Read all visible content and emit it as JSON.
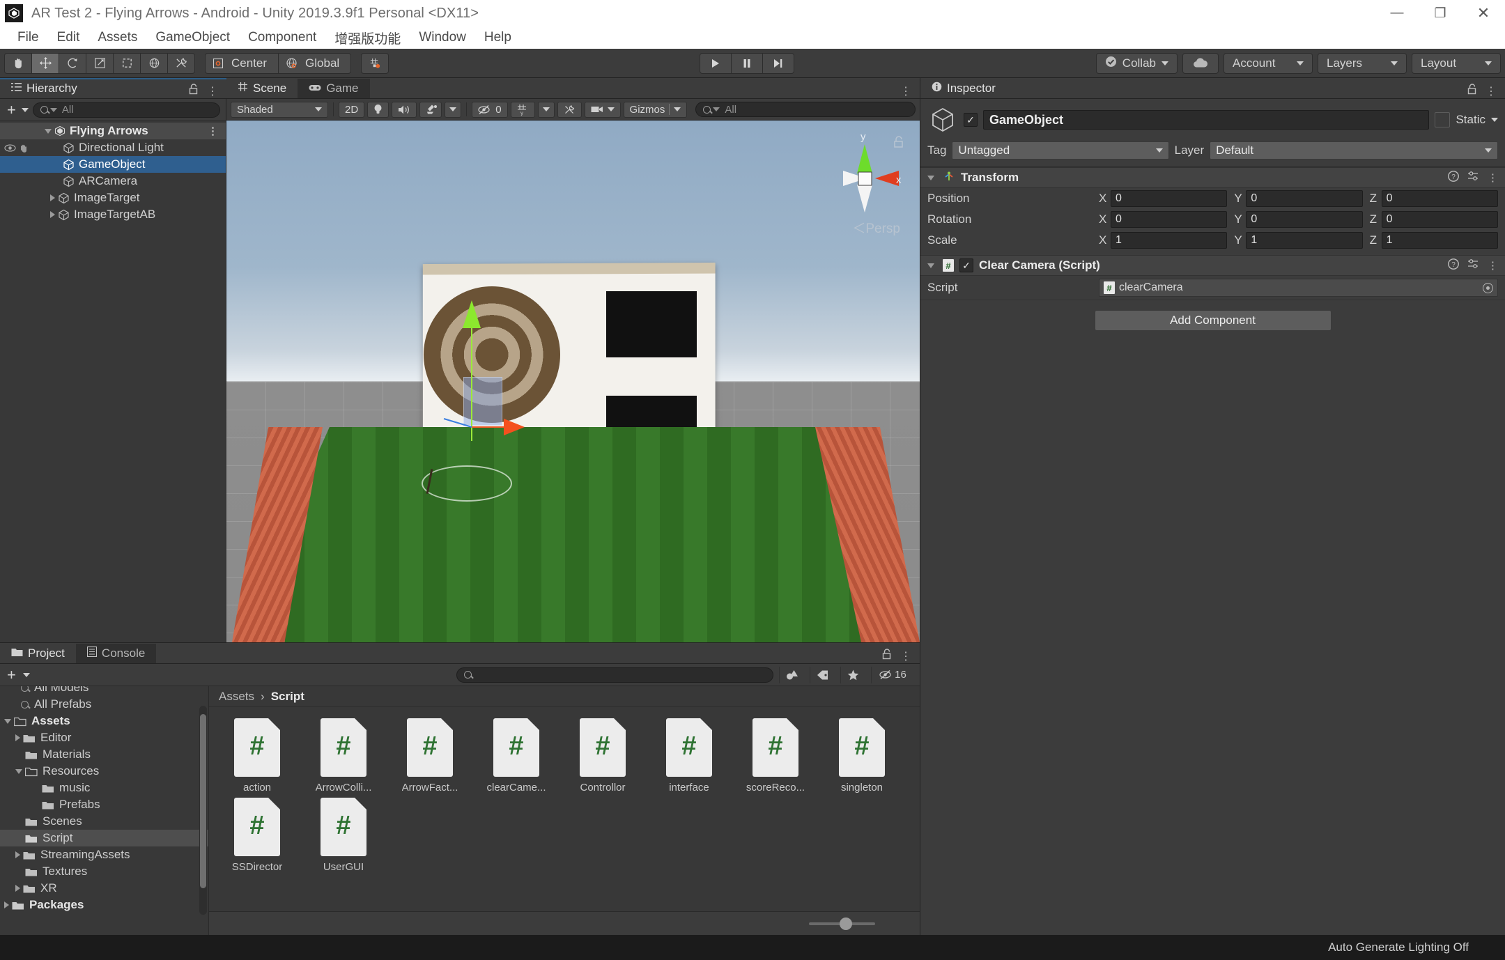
{
  "window": {
    "title": "AR Test 2 - Flying Arrows - Android - Unity 2019.3.9f1 Personal <DX11>",
    "minimize": "—",
    "maximize": "❐",
    "close": "✕"
  },
  "menubar": {
    "items": [
      "File",
      "Edit",
      "Assets",
      "GameObject",
      "Component",
      "增强版功能",
      "Window",
      "Help"
    ]
  },
  "toolbar": {
    "tools": [
      "hand-tool",
      "move-tool",
      "rotate-tool",
      "scale-tool",
      "rect-tool",
      "transform-tool",
      "custom-tool"
    ],
    "pivot_mode": "Center",
    "pivot_rotation": "Global",
    "play": "▶",
    "pause": "❚❚",
    "step": "▶❘",
    "collab": "Collab",
    "account": "Account",
    "layers": "Layers",
    "layout": "Layout"
  },
  "hierarchy": {
    "tab": "Hierarchy",
    "search_placeholder": "All",
    "scene_name": "Flying Arrows",
    "items": [
      {
        "label": "Directional Light",
        "indent": 1,
        "expandable": false,
        "selected": false
      },
      {
        "label": "GameObject",
        "indent": 1,
        "expandable": false,
        "selected": true
      },
      {
        "label": "ARCamera",
        "indent": 1,
        "expandable": false,
        "selected": false
      },
      {
        "label": "ImageTarget",
        "indent": 1,
        "expandable": true,
        "selected": false
      },
      {
        "label": "ImageTargetAB",
        "indent": 1,
        "expandable": true,
        "selected": false
      }
    ]
  },
  "scene": {
    "tabs": [
      {
        "label": "Scene",
        "selected": true
      },
      {
        "label": "Game",
        "selected": false
      }
    ],
    "draw_mode": "Shaded",
    "two_d": "2D",
    "hidden_count": "0",
    "gizmos": "Gizmos",
    "search_placeholder": "All",
    "projection": "Persp",
    "axis_y": "y",
    "axis_x": "x"
  },
  "inspector": {
    "tab": "Inspector",
    "object_name": "GameObject",
    "enabled": true,
    "static_label": "Static",
    "tag_label": "Tag",
    "tag_value": "Untagged",
    "layer_label": "Layer",
    "layer_value": "Default",
    "components": [
      {
        "title": "Transform",
        "rows": [
          {
            "label": "Position",
            "x": "0",
            "y": "0",
            "z": "0"
          },
          {
            "label": "Rotation",
            "x": "0",
            "y": "0",
            "z": "0"
          },
          {
            "label": "Scale",
            "x": "1",
            "y": "1",
            "z": "1"
          }
        ]
      }
    ],
    "script_component": {
      "title": "Clear Camera (Script)",
      "script_label": "Script",
      "script_value": "clearCamera"
    },
    "add_component": "Add Component"
  },
  "project": {
    "tabs": [
      {
        "label": "Project",
        "selected": true
      },
      {
        "label": "Console",
        "selected": false
      }
    ],
    "search_placeholder": "",
    "hidden_count": "16",
    "breadcrumb": [
      "Assets",
      "Script"
    ],
    "tree": [
      {
        "label": "All Models",
        "indent": 1,
        "type": "search",
        "expandable": false,
        "selected": false,
        "clipped": true
      },
      {
        "label": "All Prefabs",
        "indent": 1,
        "type": "search",
        "expandable": false,
        "selected": false
      },
      {
        "label": "Assets",
        "indent": 0,
        "type": "folder-open",
        "expandable": true,
        "expanded": true,
        "selected": false,
        "bold": true
      },
      {
        "label": "Editor",
        "indent": 1,
        "type": "folder",
        "expandable": true,
        "selected": false
      },
      {
        "label": "Materials",
        "indent": 1,
        "type": "folder",
        "expandable": false,
        "selected": false
      },
      {
        "label": "Resources",
        "indent": 1,
        "type": "folder-open",
        "expandable": true,
        "expanded": true,
        "selected": false
      },
      {
        "label": "music",
        "indent": 2,
        "type": "folder",
        "expandable": false,
        "selected": false
      },
      {
        "label": "Prefabs",
        "indent": 2,
        "type": "folder",
        "expandable": false,
        "selected": false
      },
      {
        "label": "Scenes",
        "indent": 1,
        "type": "folder",
        "expandable": false,
        "selected": false
      },
      {
        "label": "Script",
        "indent": 1,
        "type": "folder",
        "expandable": false,
        "selected": true
      },
      {
        "label": "StreamingAssets",
        "indent": 1,
        "type": "folder",
        "expandable": true,
        "selected": false
      },
      {
        "label": "Textures",
        "indent": 1,
        "type": "folder",
        "expandable": false,
        "selected": false
      },
      {
        "label": "XR",
        "indent": 1,
        "type": "folder",
        "expandable": true,
        "selected": false
      },
      {
        "label": "Packages",
        "indent": 0,
        "type": "folder",
        "expandable": true,
        "selected": false,
        "bold": true
      }
    ],
    "assets": [
      {
        "name": "action",
        "type": "csharp-script"
      },
      {
        "name": "ArrowColli...",
        "type": "csharp-script"
      },
      {
        "name": "ArrowFact...",
        "type": "csharp-script"
      },
      {
        "name": "clearCame...",
        "type": "csharp-script"
      },
      {
        "name": "Controllor",
        "type": "csharp-script"
      },
      {
        "name": "interface",
        "type": "csharp-script"
      },
      {
        "name": "scoreReco...",
        "type": "csharp-script"
      },
      {
        "name": "singleton",
        "type": "csharp-script"
      },
      {
        "name": "SSDirector",
        "type": "csharp-script"
      },
      {
        "name": "UserGUI",
        "type": "csharp-script"
      }
    ]
  },
  "statusbar": {
    "message": "Auto Generate Lighting Off"
  },
  "colors": {
    "selection_blue": "#2f5f8f",
    "accent_orange": "#e8662c",
    "panel_bg": "#3c3c3c",
    "script_green": "#2f7333"
  }
}
